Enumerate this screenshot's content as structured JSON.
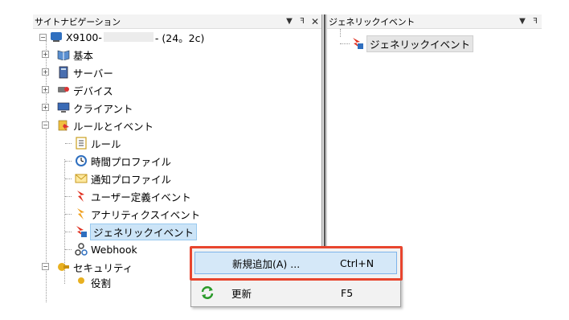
{
  "left_pane": {
    "title": "サイトナビゲーション",
    "pin_glyph": "▾ ⊣",
    "close_glyph": "✕"
  },
  "right_pane": {
    "title": "ジェネリックイベント",
    "item": "ジェネリックイベント"
  },
  "tree": {
    "root_prefix": "X9100-",
    "root_suffix": "- (24。2c)",
    "items": [
      {
        "label": "基本",
        "icon": "book-icon"
      },
      {
        "label": "サーバー",
        "icon": "server-icon"
      },
      {
        "label": "デバイス",
        "icon": "camera-icon"
      },
      {
        "label": "クライアント",
        "icon": "monitor-icon"
      },
      {
        "label": "ルールとイベント",
        "icon": "rules-icon"
      },
      {
        "label": "ルール",
        "icon": "rule-doc-icon"
      },
      {
        "label": "時間プロファイル",
        "icon": "clock-icon"
      },
      {
        "label": "通知プロファイル",
        "icon": "envelope-icon"
      },
      {
        "label": "ユーザー定義イベント",
        "icon": "user-event-icon"
      },
      {
        "label": "アナリティクスイベント",
        "icon": "analytics-event-icon"
      },
      {
        "label": "ジェネリックイベント",
        "icon": "generic-event-icon"
      },
      {
        "label": "Webhook",
        "icon": "webhook-icon"
      },
      {
        "label": "セキュリティ",
        "icon": "security-icon"
      },
      {
        "label": "役割",
        "icon": "role-icon"
      }
    ]
  },
  "context_menu": {
    "items": [
      {
        "label": "新規追加(A) ...",
        "shortcut": "Ctrl+N",
        "icon": ""
      },
      {
        "label": "更新",
        "shortcut": "F5",
        "icon": "refresh-icon"
      }
    ]
  },
  "colors": {
    "highlight_box": "#e8452e",
    "menu_hover": "#d5e8f8",
    "selection": "#cce4f7"
  }
}
